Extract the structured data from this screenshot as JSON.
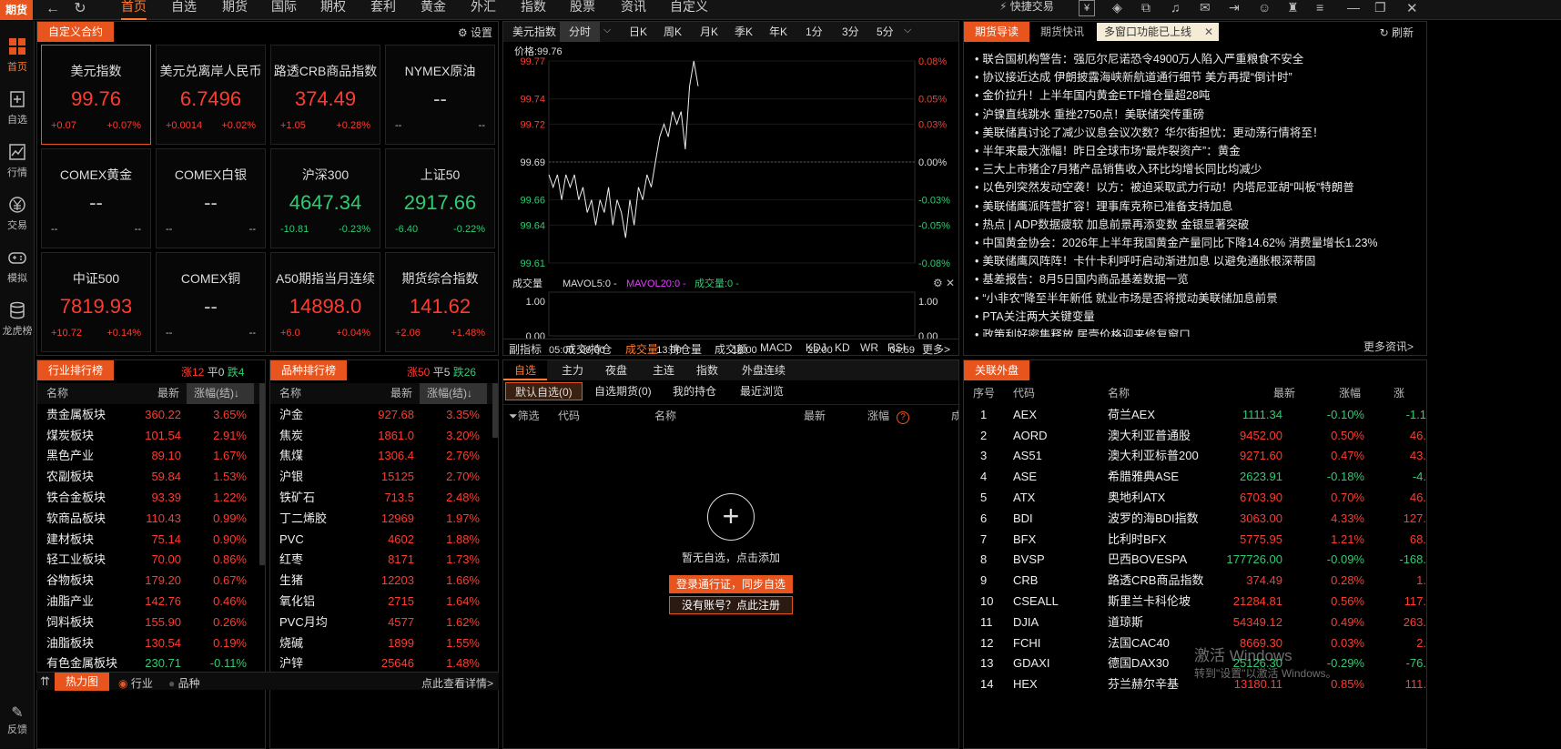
{
  "app": {
    "logo": "期货",
    "watermark_line1": "激活 Windows",
    "watermark_line2": "转到\"设置\"以激活 Windows。"
  },
  "menu": [
    "首页",
    "自选",
    "期货",
    "国际",
    "期权",
    "套利",
    "黄金",
    "外汇",
    "指数",
    "股票",
    "资讯",
    "自定义"
  ],
  "menu_active": 0,
  "toolbar": {
    "quick_trade": "快捷交易"
  },
  "sidebar": [
    {
      "label": "首页",
      "icon": "grid-icon"
    },
    {
      "label": "自选",
      "icon": "add-page-icon"
    },
    {
      "label": "行情",
      "icon": "chart-icon"
    },
    {
      "label": "交易",
      "icon": "yen-icon"
    },
    {
      "label": "模拟",
      "icon": "gamepad-icon"
    },
    {
      "label": "龙虎榜",
      "icon": "database-icon"
    }
  ],
  "sidebar_bottom": "反馈",
  "custom": {
    "title": "自定义合约",
    "settings": "设置",
    "cards": [
      {
        "name": "美元指数",
        "price": "99.76",
        "chg": "+0.07",
        "pct": "+0.07%",
        "dir": "up"
      },
      {
        "name": "美元兑离岸人民币",
        "price": "6.7496",
        "chg": "+0.0014",
        "pct": "+0.02%",
        "dir": "up"
      },
      {
        "name": "路透CRB商品指数",
        "price": "374.49",
        "chg": "+1.05",
        "pct": "+0.28%",
        "dir": "up"
      },
      {
        "name": "NYMEX原油",
        "price": "--",
        "chg": "--",
        "pct": "--",
        "dir": "gy"
      },
      {
        "name": "COMEX黄金",
        "price": "--",
        "chg": "--",
        "pct": "--",
        "dir": "gy"
      },
      {
        "name": "COMEX白银",
        "price": "--",
        "chg": "--",
        "pct": "--",
        "dir": "gy"
      },
      {
        "name": "沪深300",
        "price": "4647.34",
        "chg": "-10.81",
        "pct": "-0.23%",
        "dir": "dn"
      },
      {
        "name": "上证50",
        "price": "2917.66",
        "chg": "-6.40",
        "pct": "-0.22%",
        "dir": "dn"
      },
      {
        "name": "中证500",
        "price": "7819.93",
        "chg": "+10.72",
        "pct": "+0.14%",
        "dir": "up"
      },
      {
        "name": "COMEX铜",
        "price": "--",
        "chg": "--",
        "pct": "--",
        "dir": "gy"
      },
      {
        "name": "A50期指当月连续",
        "price": "14898.0",
        "chg": "+6.0",
        "pct": "+0.04%",
        "dir": "up"
      },
      {
        "name": "期货综合指数",
        "price": "141.62",
        "chg": "+2.06",
        "pct": "+1.48%",
        "dir": "up"
      }
    ]
  },
  "chart_tabs": [
    "美元指数",
    "分时",
    "日K",
    "周K",
    "月K",
    "季K",
    "年K",
    "1分",
    "3分",
    "5分"
  ],
  "chart_data": {
    "type": "line",
    "title": "价格:99.76",
    "y_ticks_left": [
      "99.77",
      "99.74",
      "99.72",
      "99.69",
      "99.66",
      "99.64",
      "99.61"
    ],
    "y_ticks_right": [
      "0.08%",
      "0.05%",
      "0.03%",
      "0.00%",
      "-0.03%",
      "-0.05%",
      "-0.08%"
    ],
    "x_ticks": [
      "05:00",
      "08:00",
      "13:00",
      "18:00",
      "23:00",
      "04:59"
    ],
    "ylim": [
      99.61,
      99.77
    ],
    "baseline": 99.69,
    "x": [
      0,
      2,
      4,
      6,
      8,
      10,
      12,
      14,
      16,
      18,
      20,
      22,
      24,
      26,
      28,
      30,
      32,
      34,
      36,
      38,
      40,
      42,
      44,
      46,
      48,
      50,
      52,
      54,
      56,
      58,
      60,
      62,
      64,
      66,
      68,
      70
    ],
    "y": [
      99.68,
      99.67,
      99.68,
      99.66,
      99.68,
      99.67,
      99.68,
      99.66,
      99.67,
      99.65,
      99.66,
      99.64,
      99.66,
      99.65,
      99.67,
      99.64,
      99.66,
      99.65,
      99.63,
      99.66,
      99.64,
      99.67,
      99.66,
      99.68,
      99.67,
      99.69,
      99.71,
      99.72,
      99.71,
      99.73,
      99.72,
      99.73,
      99.7,
      99.75,
      99.77,
      99.75
    ],
    "volume_title": "成交量",
    "vol_ticks": [
      "1.00",
      "0.00"
    ],
    "mavol5": "MAVOL5:0 -",
    "mavol20": "MAVOL20:0 -",
    "vol": "成交量:0 -"
  },
  "indicator_tabs": [
    "副指标",
    "成交/持仓",
    "成交量",
    "持仓量",
    "成交额",
    "MACD",
    "KDJ",
    "KD",
    "WR",
    "RSI",
    "更多>"
  ],
  "news": {
    "tabs": [
      "期货导读",
      "期货快讯"
    ],
    "notice": "多窗口功能已上线",
    "refresh": "刷新",
    "more": "更多资讯>",
    "items": [
      "联合国机构警告：强厄尔尼诺恐令4900万人陷入严重粮食不安全",
      "协议接近达成 伊朗披露海峡新航道通行细节 美方再提“倒计时”",
      "金价拉升！上半年国内黄金ETF增仓量超28吨",
      "沪镍直线跳水 重挫2750点！美联储突传重磅",
      "美联储真讨论了减少议息会议次数？华尔街担忧：更动荡行情将至！",
      "半年来最大涨幅！昨日全球市场“最炸裂资产”：黄金",
      "三大上市猪企7月猪产品销售收入环比均增长同比均减少",
      "以色列突然发动空袭！以方：被迫采取武力行动！内塔尼亚胡“叫板”特朗普",
      "美联储鹰派阵营扩容！理事库克称已准备支持加息",
      "热点 | ADP数据疲软  加息前景再添变数 金银显著突破",
      "中国黄金协会：2026年上半年我国黄金产量同比下降14.62% 消费量增长1.23%",
      "美联储鹰风阵阵！卡什卡利呼吁启动渐进加息 以避免通胀根深蒂固",
      "基差报告：8月5日国内商品基差数据一览",
      "“小非农”降至半年新低 就业市场是否将搅动美联储加息前景",
      "PTA关注两大关键变量",
      "政策利好密集释放 居壹价格迎来修复窗口"
    ]
  },
  "industry": {
    "title": "行业排行榜",
    "up": "涨12",
    "flat": "平0",
    "down": "跌4",
    "cols": [
      "名称",
      "最新",
      "涨幅(结)↓"
    ],
    "rows": [
      [
        "贵金属板块",
        "360.22",
        "3.65%",
        "up"
      ],
      [
        "煤炭板块",
        "101.54",
        "2.91%",
        "up"
      ],
      [
        "黑色产业",
        "89.10",
        "1.67%",
        "up"
      ],
      [
        "农副板块",
        "59.84",
        "1.53%",
        "up"
      ],
      [
        "铁合金板块",
        "93.39",
        "1.22%",
        "up"
      ],
      [
        "软商品板块",
        "110.43",
        "0.99%",
        "up"
      ],
      [
        "建材板块",
        "75.14",
        "0.90%",
        "up"
      ],
      [
        "轻工业板块",
        "70.00",
        "0.86%",
        "up"
      ],
      [
        "谷物板块",
        "179.20",
        "0.67%",
        "up"
      ],
      [
        "油脂产业",
        "142.76",
        "0.46%",
        "up"
      ],
      [
        "饲料板块",
        "155.90",
        "0.26%",
        "up"
      ],
      [
        "油脂板块",
        "130.54",
        "0.19%",
        "up"
      ],
      [
        "有色金属板块",
        "230.71",
        "-0.11%",
        "dn"
      ]
    ]
  },
  "variety": {
    "title": "品种排行榜",
    "up": "涨50",
    "flat": "平5",
    "down": "跌26",
    "cols": [
      "名称",
      "最新",
      "涨幅(结)↓"
    ],
    "rows": [
      [
        "沪金",
        "927.68",
        "3.35%",
        "up"
      ],
      [
        "焦炭",
        "1861.0",
        "3.20%",
        "up"
      ],
      [
        "焦煤",
        "1306.4",
        "2.76%",
        "up"
      ],
      [
        "沪银",
        "15125",
        "2.70%",
        "up"
      ],
      [
        "铁矿石",
        "713.5",
        "2.48%",
        "up"
      ],
      [
        "丁二烯胶",
        "12969",
        "1.97%",
        "up"
      ],
      [
        "PVC",
        "4602",
        "1.88%",
        "up"
      ],
      [
        "红枣",
        "8171",
        "1.73%",
        "up"
      ],
      [
        "生猪",
        "12203",
        "1.66%",
        "up"
      ],
      [
        "氧化铝",
        "2715",
        "1.64%",
        "up"
      ],
      [
        "PVC月均",
        "4577",
        "1.62%",
        "up"
      ],
      [
        "烧碱",
        "1899",
        "1.55%",
        "up"
      ],
      [
        "沪锌",
        "25646",
        "1.48%",
        "up"
      ]
    ]
  },
  "bottom_left": {
    "heatmap": "热力图",
    "radio1": "行业",
    "radio2": "品种",
    "detail": "点此查看详情>"
  },
  "watch": {
    "tabs": [
      "自选",
      "主力",
      "夜盘",
      "主连",
      "指数",
      "外盘连续"
    ],
    "subtabs": [
      "默认自选(0)",
      "自选期货(0)",
      "我的持仓",
      "最近浏览"
    ],
    "cols": [
      "筛选",
      "代码",
      "名称",
      "最新",
      "涨幅",
      "成"
    ],
    "empty": "暂无自选，点击添加",
    "login": "登录通行证，同步自选",
    "register": "没有账号？点此注册"
  },
  "foreign": {
    "title": "关联外盘",
    "cols": [
      "序号",
      "代码",
      "名称",
      "最新",
      "涨幅",
      "涨"
    ],
    "rows": [
      [
        "1",
        "AEX",
        "荷兰AEX",
        "1111.34",
        "-0.10%",
        "-1.1",
        "dn"
      ],
      [
        "2",
        "AORD",
        "澳大利亚普通股",
        "9452.00",
        "0.50%",
        "46.",
        "up"
      ],
      [
        "3",
        "AS51",
        "澳大利亚标普200",
        "9271.60",
        "0.47%",
        "43.",
        "up"
      ],
      [
        "4",
        "ASE",
        "希腊雅典ASE",
        "2623.91",
        "-0.18%",
        "-4.",
        "dn"
      ],
      [
        "5",
        "ATX",
        "奥地利ATX",
        "6703.90",
        "0.70%",
        "46.",
        "up"
      ],
      [
        "6",
        "BDI",
        "波罗的海BDI指数",
        "3063.00",
        "4.33%",
        "127.",
        "up"
      ],
      [
        "7",
        "BFX",
        "比利时BFX",
        "5775.95",
        "1.21%",
        "68.",
        "up"
      ],
      [
        "8",
        "BVSP",
        "巴西BOVESPA",
        "177726.00",
        "-0.09%",
        "-168.",
        "dn"
      ],
      [
        "9",
        "CRB",
        "路透CRB商品指数",
        "374.49",
        "0.28%",
        "1.",
        "up"
      ],
      [
        "10",
        "CSEALL",
        "斯里兰卡科伦坡",
        "21284.81",
        "0.56%",
        "117.",
        "up"
      ],
      [
        "11",
        "DJIA",
        "道琼斯",
        "54349.12",
        "0.49%",
        "263.",
        "up"
      ],
      [
        "12",
        "FCHI",
        "法国CAC40",
        "8669.30",
        "0.03%",
        "2.",
        "up"
      ],
      [
        "13",
        "GDAXI",
        "德国DAX30",
        "25126.30",
        "-0.29%",
        "-76.",
        "dn"
      ],
      [
        "14",
        "HEX",
        "芬兰赫尔辛基",
        "13180.11",
        "0.85%",
        "111.",
        "up"
      ]
    ]
  }
}
